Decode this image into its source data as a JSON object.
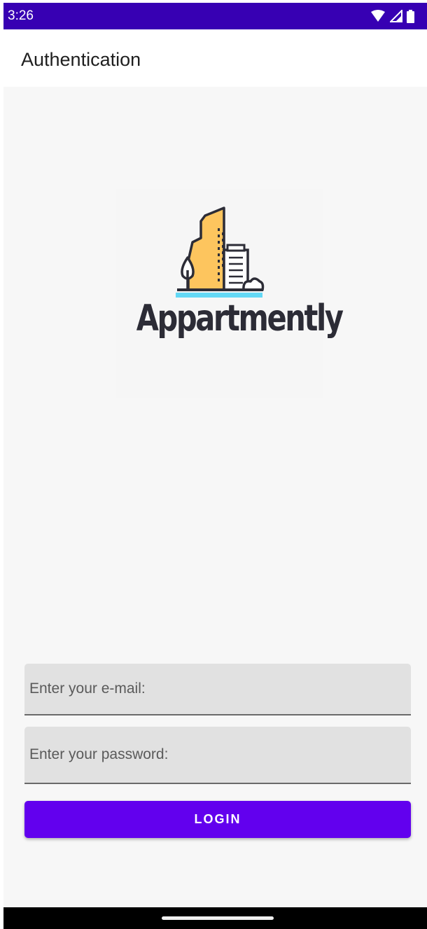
{
  "status_bar": {
    "time": "3:26",
    "icons": [
      "wifi-icon",
      "signal-icon",
      "battery-icon"
    ],
    "background": "#3700b3"
  },
  "app_bar": {
    "title": "Authentication"
  },
  "logo": {
    "brand_text": "Appartmently"
  },
  "form": {
    "email_placeholder": "Enter your e-mail:",
    "password_placeholder": "Enter your password:",
    "login_label": "LOGIN"
  },
  "colors": {
    "primary": "#6200ee",
    "primary_dark": "#3700b3",
    "logo_yellow": "#fdc55e",
    "logo_cyan": "#63d8f5",
    "logo_dark": "#2c2c36"
  }
}
